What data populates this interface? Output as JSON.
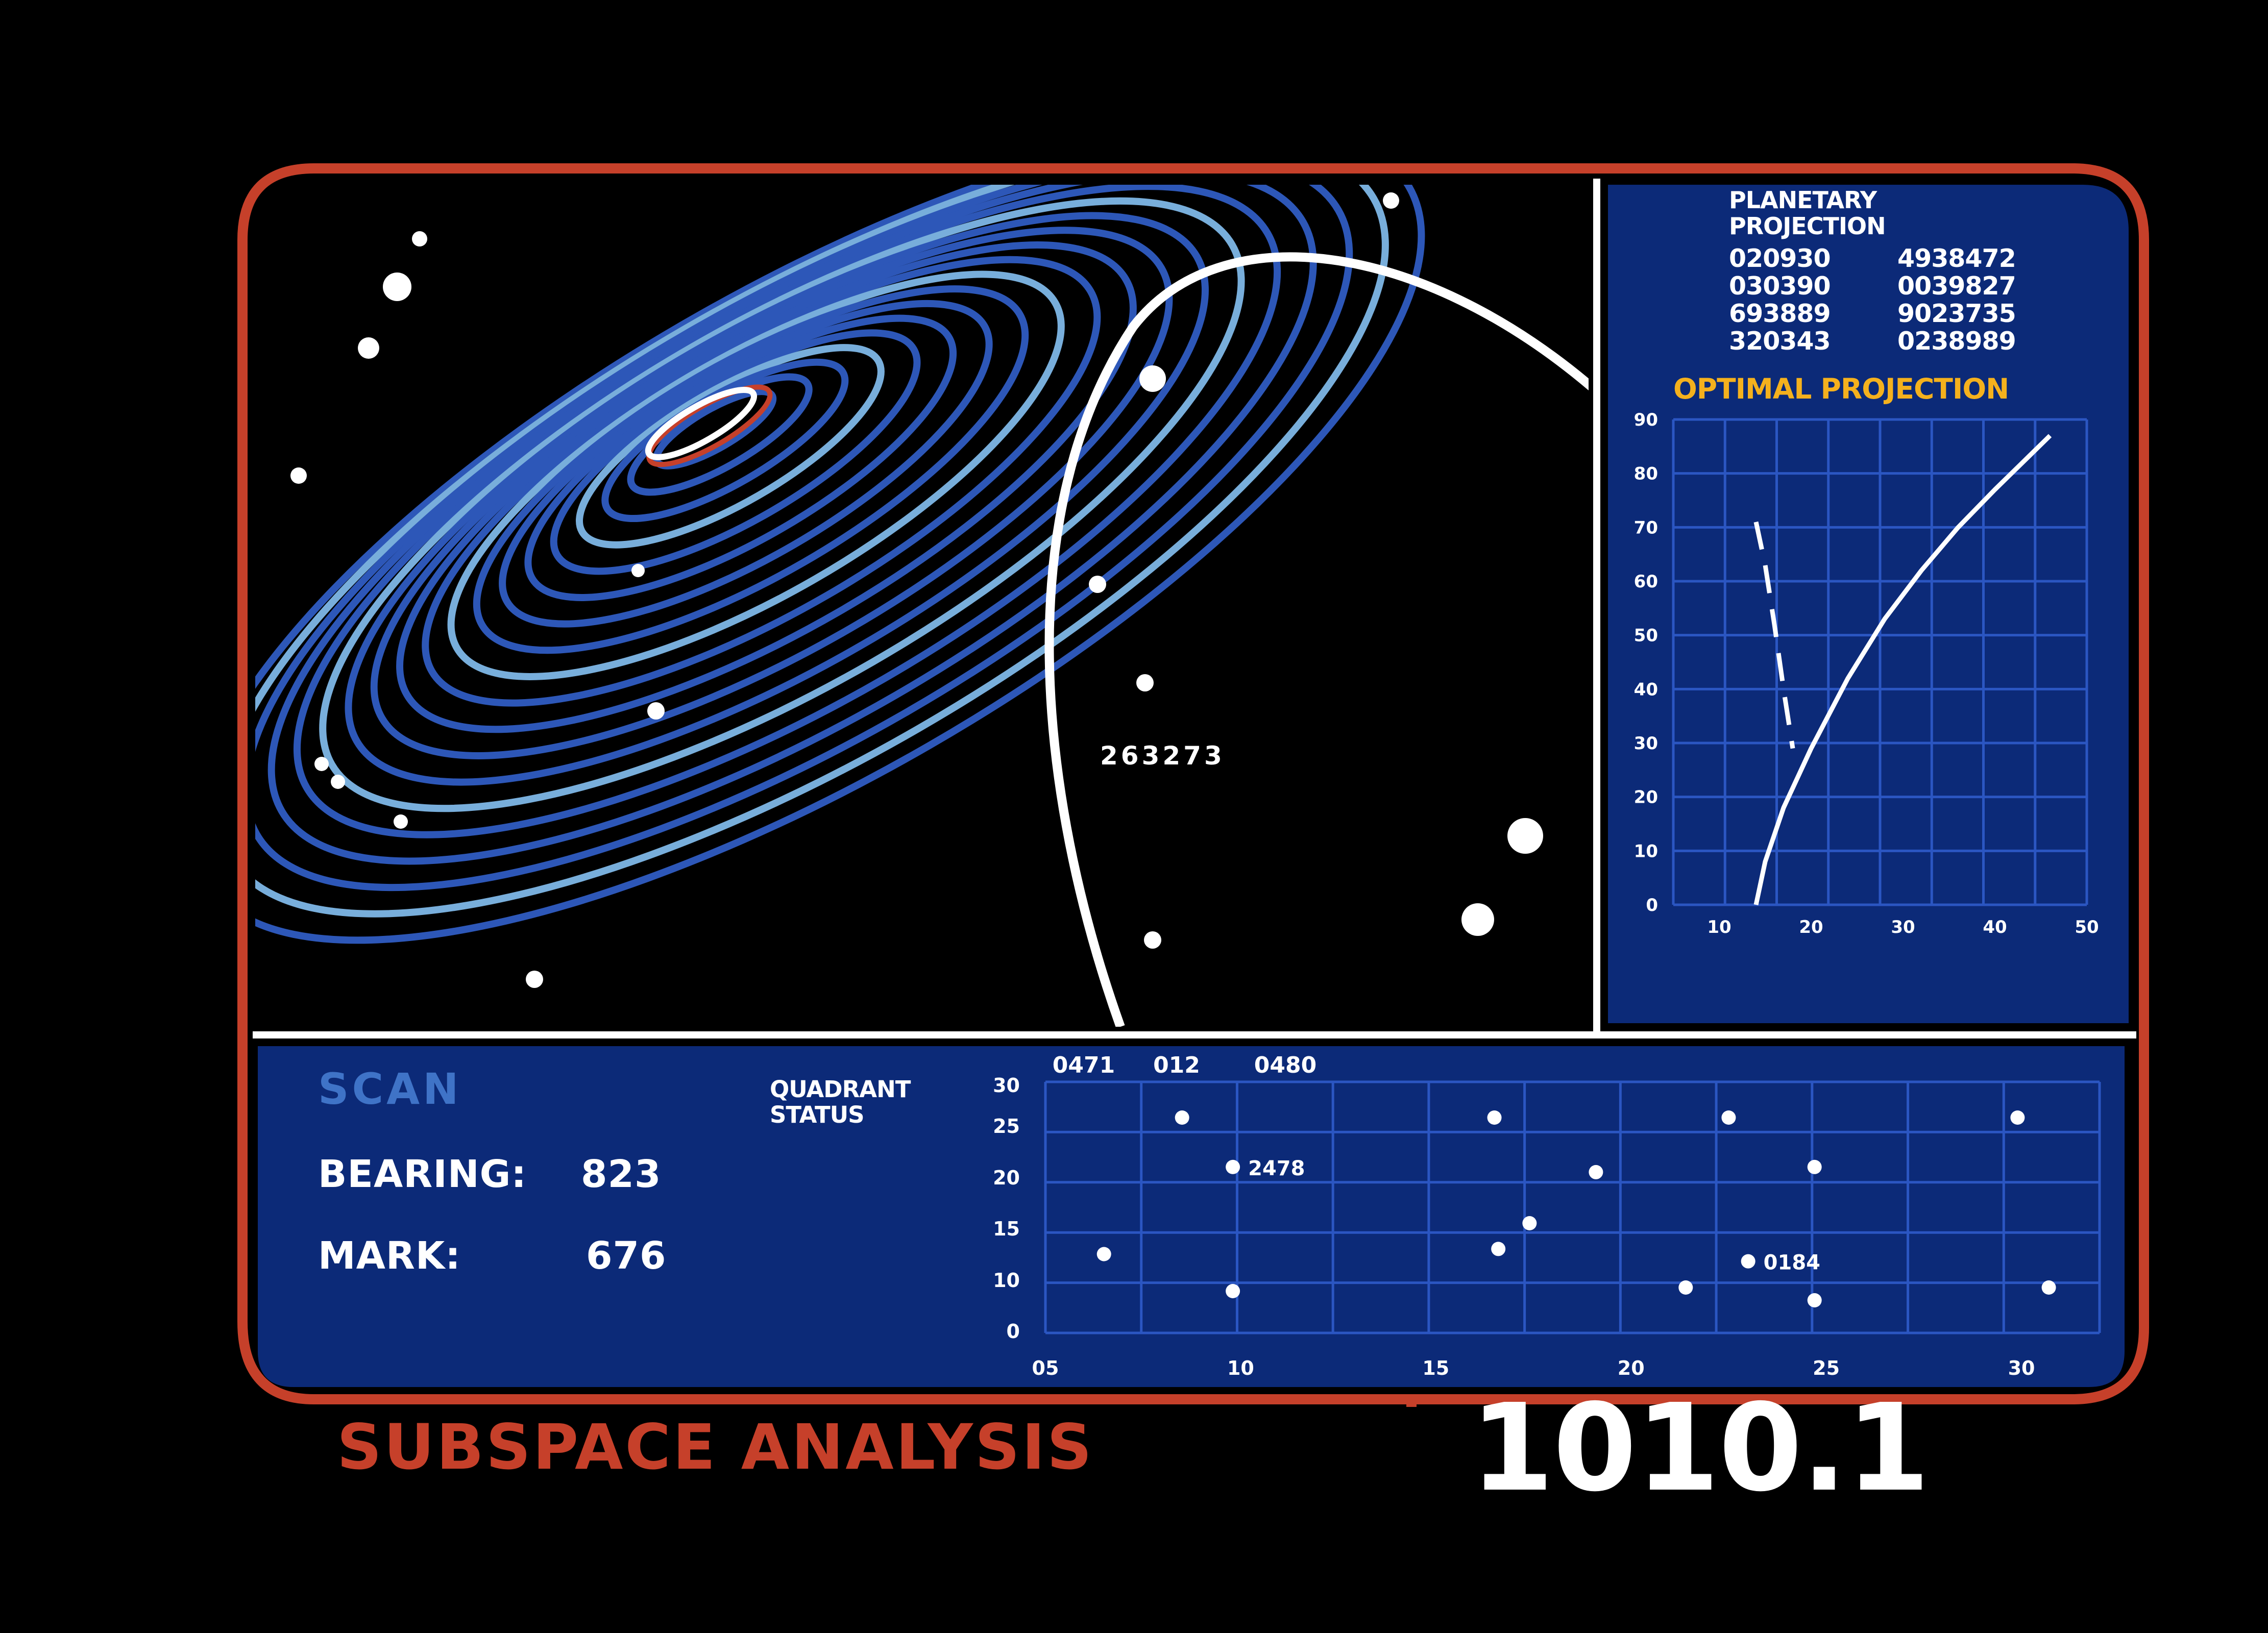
{
  "colors": {
    "frame": "#c6402a",
    "panel": "#0c2a78",
    "grid": "#2b56c2",
    "ring_dark": "#2d57b8",
    "ring_light": "#78aedb",
    "accent": "#f5b11d",
    "white": "#ffffff",
    "scan": "#3f73c7"
  },
  "icons": [
    "star-icon",
    "orbit-ring-icon",
    "trajectory-arc-icon"
  ],
  "subspace_view": {
    "marker_label": "263273"
  },
  "planetary_projection": {
    "title": [
      "PLANETARY",
      "PROJECTION"
    ],
    "column_1": [
      "020930",
      "030390",
      "693889",
      "320343"
    ],
    "column_2": [
      "4938472",
      "0039827",
      "9023735",
      "0238989"
    ]
  },
  "scan_panel": {
    "title": "SCAN",
    "bearing_label": "BEARING:",
    "bearing_value": "823",
    "mark_label": "MARK:",
    "mark_value": "676",
    "quadrant_label": [
      "QUADRANT",
      "STATUS"
    ]
  },
  "footer": {
    "title": "SUBSPACE ANALYSIS",
    "id": "1010.1"
  },
  "chart_data": [
    {
      "type": "line",
      "title": "OPTIMAL PROJECTION",
      "xlabel": "",
      "ylabel": "",
      "x_ticks": [
        "10",
        "20",
        "30",
        "40",
        "50"
      ],
      "y_ticks": [
        "0",
        "10",
        "20",
        "30",
        "40",
        "50",
        "60",
        "70",
        "80",
        "90"
      ],
      "xlim": [
        5,
        50
      ],
      "ylim": [
        0,
        90
      ],
      "grid": true,
      "series": [
        {
          "style": "solid",
          "x": [
            14,
            15,
            17,
            20,
            24,
            28,
            32,
            36,
            40,
            43,
            46
          ],
          "y": [
            0,
            8,
            18,
            29,
            42,
            53,
            62,
            70,
            77,
            82,
            87
          ]
        },
        {
          "style": "dashed",
          "x": [
            14,
            15,
            16,
            17,
            18
          ],
          "y": [
            71,
            63,
            52,
            40,
            29
          ]
        }
      ]
    },
    {
      "type": "scatter",
      "title": "",
      "top_labels": [
        "0471",
        "012",
        "0480"
      ],
      "x_ticks": [
        "05",
        "10",
        "15",
        "20",
        "25",
        "30"
      ],
      "y_ticks": [
        "0",
        "10",
        "15",
        "20",
        "25",
        "30"
      ],
      "xlim": [
        5,
        32
      ],
      "grid": true,
      "points": [
        {
          "x": 6.5,
          "y": 12.5,
          "label": ""
        },
        {
          "x": 8.5,
          "y": 26,
          "label": ""
        },
        {
          "x": 9.8,
          "y": 21,
          "label": "2478"
        },
        {
          "x": 9.8,
          "y": 7.8,
          "label": ""
        },
        {
          "x": 16.5,
          "y": 26,
          "label": ""
        },
        {
          "x": 16.6,
          "y": 13,
          "label": ""
        },
        {
          "x": 17.4,
          "y": 15.5,
          "label": ""
        },
        {
          "x": 19.1,
          "y": 20.5,
          "label": ""
        },
        {
          "x": 21.4,
          "y": 8.5,
          "label": ""
        },
        {
          "x": 22.5,
          "y": 26,
          "label": ""
        },
        {
          "x": 23.0,
          "y": 11.8,
          "label": "0184"
        },
        {
          "x": 24.7,
          "y": 21,
          "label": ""
        },
        {
          "x": 24.7,
          "y": 6,
          "label": ""
        },
        {
          "x": 29.9,
          "y": 26,
          "label": ""
        },
        {
          "x": 30.7,
          "y": 8.5,
          "label": ""
        }
      ]
    }
  ]
}
